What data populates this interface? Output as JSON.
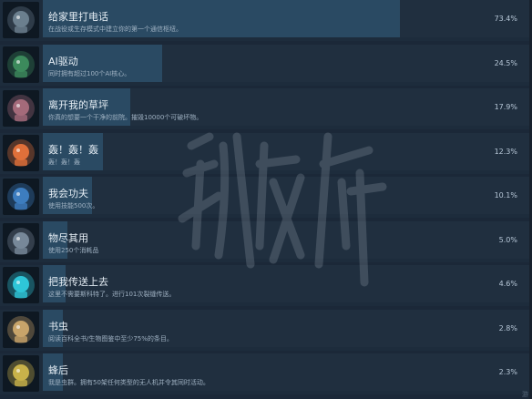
{
  "achievements": [
    {
      "title": "给家里打电话",
      "desc": "在战役或生存模式中建立你的第一个通信枢纽。",
      "percent": "73.4%",
      "fill": 0.734,
      "icon": "communication-hub-icon",
      "icon_color": "#6b7f8e"
    },
    {
      "title": "AI驱动",
      "desc": "同时拥有超过100个AI核心。",
      "percent": "24.5%",
      "fill": 0.245,
      "icon": "ai-server-rack-icon",
      "icon_color": "#3c8a5c"
    },
    {
      "title": "离开我的草坪",
      "desc": "你真的想要一个干净的前院。摧毁10000个可破坏物。",
      "percent": "17.9%",
      "fill": 0.179,
      "icon": "brain-mech-icon",
      "icon_color": "#a46a7a"
    },
    {
      "title": "轰！轰！轰",
      "desc": "轰！轰！轰",
      "percent": "12.3%",
      "fill": 0.123,
      "icon": "mushroom-explosion-icon",
      "icon_color": "#e0703a"
    },
    {
      "title": "我会功夫",
      "desc": "使用技能500次。",
      "percent": "10.1%",
      "fill": 0.101,
      "icon": "fighter-robot-icon",
      "icon_color": "#3d7dbf"
    },
    {
      "title": "物尽其用",
      "desc": "使用250个消耗品",
      "percent": "5.0%",
      "fill": 0.05,
      "icon": "drone-swarm-icon",
      "icon_color": "#778899"
    },
    {
      "title": "把我传送上去",
      "desc": "这里不需要斯科特了。进行101次裂缝传送。",
      "percent": "4.6%",
      "fill": 0.046,
      "icon": "teleporter-icon",
      "icon_color": "#2ec6d8"
    },
    {
      "title": "书虫",
      "desc": "阅读百科全书/生物图鉴中至少75%的条目。",
      "percent": "2.8%",
      "fill": 0.028,
      "icon": "encyclopedia-scroll-icon",
      "icon_color": "#c8a46a"
    },
    {
      "title": "蜂后",
      "desc": "我是虫群。拥有50架任何类型的无人机并令其同时活动。",
      "percent": "2.3%",
      "fill": 0.023,
      "icon": "queen-drone-icon",
      "icon_color": "#c8b24a"
    }
  ],
  "colors": {
    "background": "#1b2838",
    "bar_fill": "#2a4a63",
    "title_text": "#e6eef5",
    "desc_text": "#9fb1c2"
  }
}
